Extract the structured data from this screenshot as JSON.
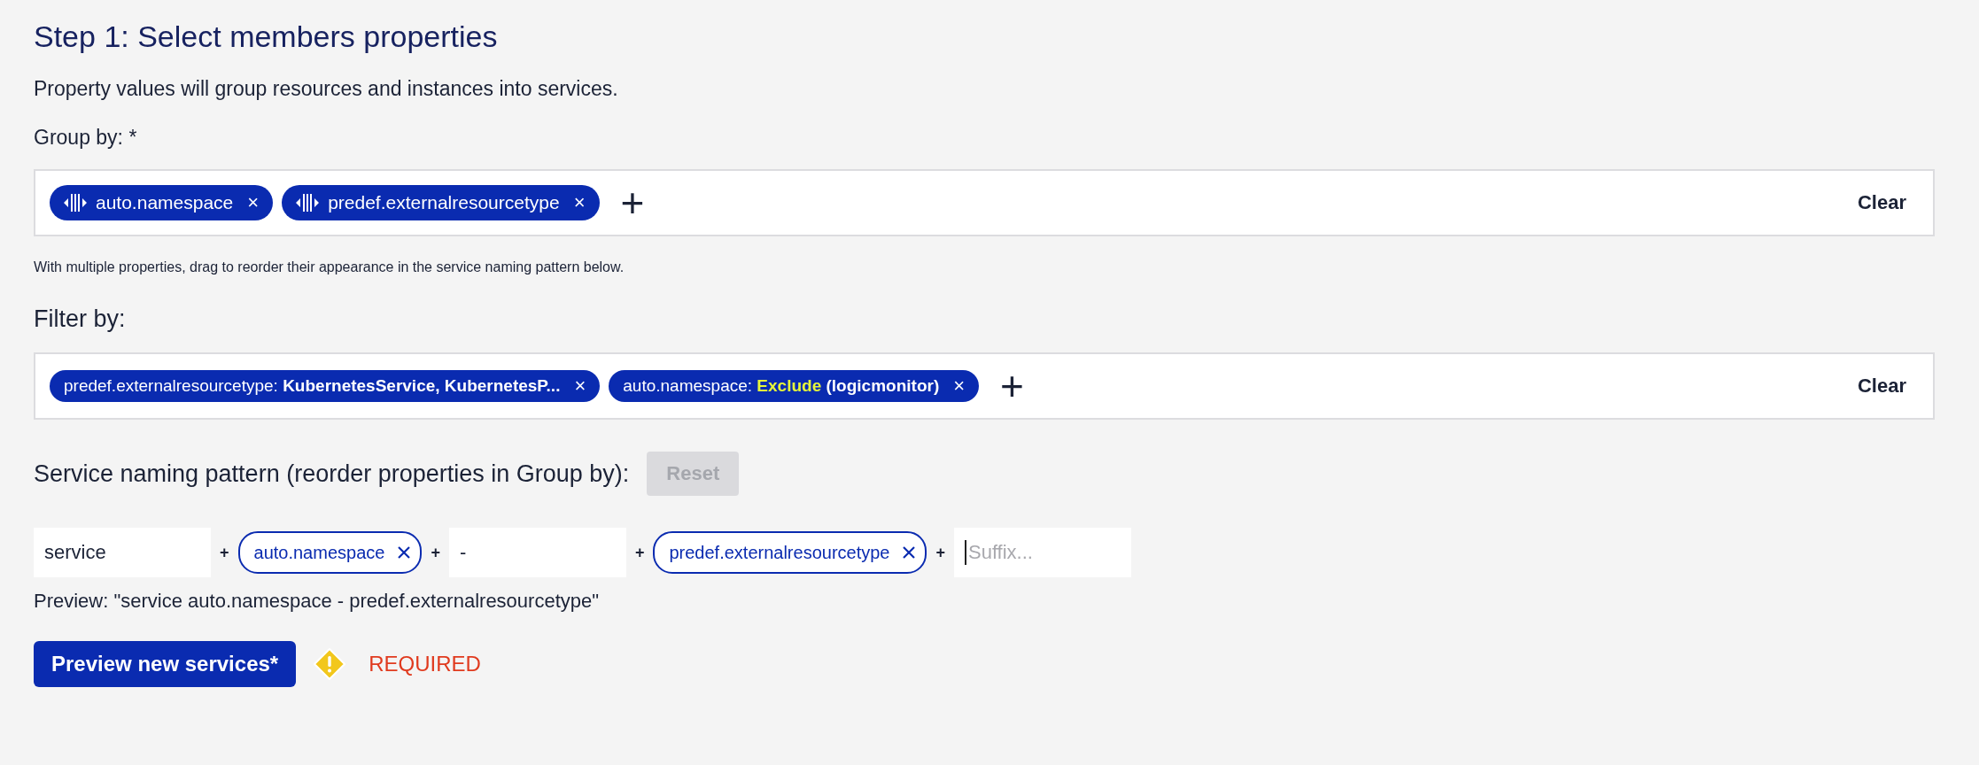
{
  "title": "Step 1: Select members properties",
  "description": "Property values will group resources and instances into services.",
  "group_by": {
    "label": "Group by: *",
    "chips": [
      {
        "label": "auto.namespace",
        "remove": "×"
      },
      {
        "label": "predef.externalresourcetype",
        "remove": "×"
      }
    ],
    "add": "+",
    "clear": "Clear",
    "hint": "With multiple properties, drag to reorder their appearance in the service naming pattern below."
  },
  "filter_by": {
    "label": "Filter by:",
    "chips": [
      {
        "property": "predef.externalresourcetype:",
        "value": "KubernetesService, KubernetesP...",
        "remove": "×"
      },
      {
        "property": "auto.namespace:",
        "operator": "Exclude",
        "value": "(logicmonitor)",
        "remove": "×"
      }
    ],
    "add": "+",
    "clear": "Clear"
  },
  "naming_pattern": {
    "label": "Service naming pattern (reorder properties in Group by):",
    "reset": {
      "label": "Reset",
      "disabled": true
    },
    "items": [
      {
        "kind": "field",
        "value": "service"
      },
      {
        "kind": "plus",
        "text": "+"
      },
      {
        "kind": "chip",
        "label": "auto.namespace"
      },
      {
        "kind": "plus",
        "text": "+"
      },
      {
        "kind": "field",
        "value": "-"
      },
      {
        "kind": "plus",
        "text": "+"
      },
      {
        "kind": "chip",
        "label": "predef.externalresourcetype"
      },
      {
        "kind": "plus",
        "text": "+"
      },
      {
        "kind": "field",
        "placeholder": "Suffix...",
        "focused": true
      }
    ],
    "preview": "Preview: \"service auto.namespace - predef.externalresourcetype\""
  },
  "action": {
    "label": "Preview new services*",
    "status": "REQUIRED"
  }
}
